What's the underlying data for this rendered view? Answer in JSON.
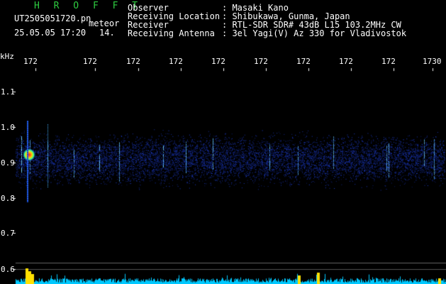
{
  "header": {
    "title": "H R O F F T",
    "filename": "UT2505051720.pn",
    "category": "meteor",
    "datetime": "25.05.05 17:20",
    "count": "14.",
    "info": [
      {
        "label": "Observer",
        "value": ": Masaki Kano"
      },
      {
        "label": "Receiving Location",
        "value": ": Shibukawa, Gunma, Japan"
      },
      {
        "label": "Receiver",
        "value": ": RTL-SDR SDR# 43dB L15 103.2MHz CW"
      },
      {
        "label": "Receiving Antenna",
        "value": ": 3el Yagi(V) Az 330 for Vladivostok"
      }
    ]
  },
  "x_axis": {
    "ticks": [
      "172",
      "172",
      "172",
      "172",
      "172",
      "172",
      "172",
      "172",
      "172",
      "1730"
    ]
  },
  "y_axis": {
    "unit": "kHz",
    "ticks": [
      "1.1",
      "1.0",
      "0.9",
      "0.8",
      "0.7",
      "0.6"
    ]
  },
  "colors": {
    "background": "#000000",
    "title_green": "#2ecc40",
    "text": "#ffffff",
    "signal_band": "#1a3cff",
    "signal_peak": "#ff3030",
    "noise_trace": "#00c8ff",
    "burst_yellow": "#ffe000"
  }
}
